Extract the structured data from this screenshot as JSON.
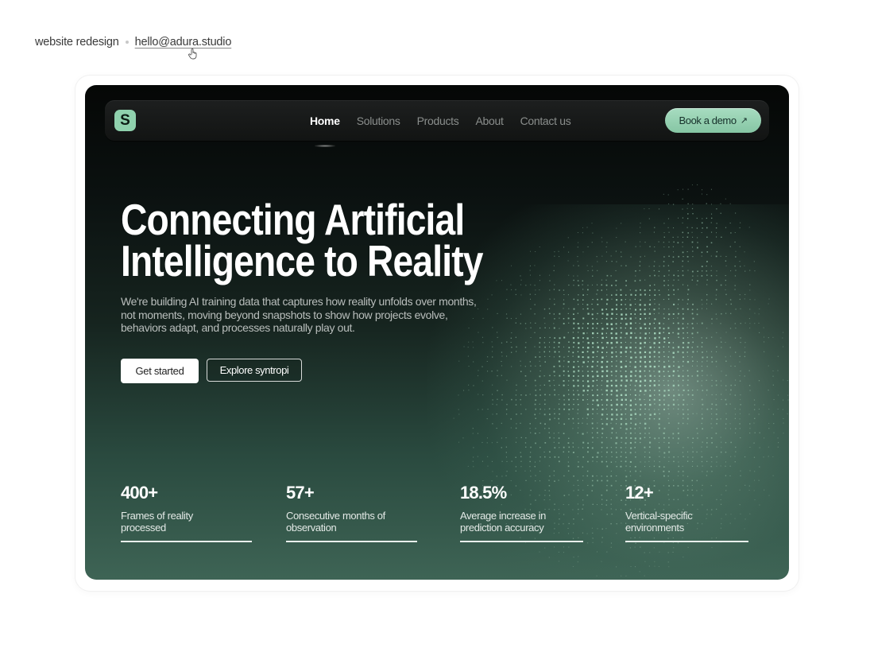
{
  "top_meta": {
    "project": "website redesign",
    "email": "hello@adura.studio"
  },
  "nav": {
    "logo_letter": "S",
    "links": [
      "Home",
      "Solutions",
      "Products",
      "About",
      "Contact us"
    ],
    "active": "Home",
    "cta_label": "Book a demo",
    "cta_icon": "arrow-up-right-icon"
  },
  "hero": {
    "headline_line1": "Connecting Artificial",
    "headline_line2": "Intelligence to Reality",
    "subtext": "We're building AI training data that captures how reality unfolds over months, not moments, moving beyond snapshots to show how projects evolve, behaviors adapt, and processes naturally play out.",
    "primary_button": "Get started",
    "secondary_button": "Explore syntropi"
  },
  "stats": [
    {
      "value": "400+",
      "label": "Frames of reality processed"
    },
    {
      "value": "57+",
      "label": "Consecutive months of observation"
    },
    {
      "value": "18.5%",
      "label": "Average increase in prediction accuracy"
    },
    {
      "value": "12+",
      "label": "Vertical-specific environments"
    }
  ],
  "colors": {
    "accent_green": "#8fd1ad",
    "hero_dark": "#050706",
    "hero_green": "#3e6455"
  }
}
